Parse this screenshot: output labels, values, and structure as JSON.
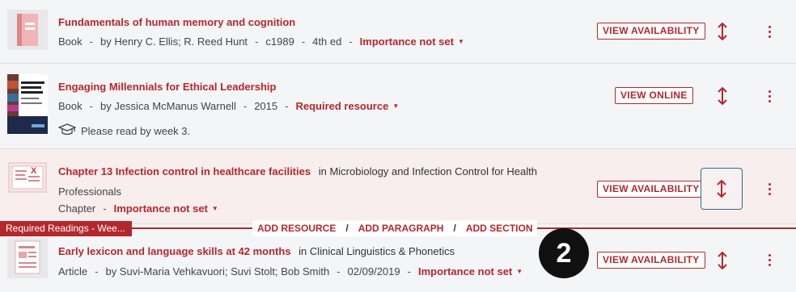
{
  "items": [
    {
      "title": "Fundamentals of human memory and cognition",
      "type": "Book",
      "authors": "by Henry C. Ellis; R. Reed Hunt",
      "date": "c1989",
      "edition": "4th ed",
      "importance": "Importance not set",
      "action": "VIEW AVAILABILITY"
    },
    {
      "title": "Engaging Millennials for Ethical Leadership",
      "type": "Book",
      "authors": "by Jessica McManus Warnell",
      "date": "2015",
      "importance": "Required resource",
      "note": "Please read by week 3.",
      "action": "VIEW ONLINE",
      "cover_text": "Engaging Millennials for Ethical Leadership"
    },
    {
      "title": "Chapter 13 Infection control in healthcare facilities",
      "in_prefix": "in",
      "container_line1": "Microbiology and Infection Control for Health",
      "container_line2": "Professionals",
      "type": "Chapter",
      "importance": "Importance not set",
      "action": "VIEW AVAILABILITY"
    },
    {
      "title": "Early lexicon and language skills at 42 months",
      "in_prefix": "in",
      "container_line1": "Clinical Linguistics & Phonetics",
      "type": "Article",
      "authors": "by Suvi-Maria Vehkavuori; Suvi Stolt; Bob Smith",
      "date": "02/09/2019",
      "importance": "Importance not set",
      "action": "VIEW AVAILABILITY"
    }
  ],
  "section": {
    "label": "Required Readings - Wee...",
    "add_resource": "ADD RESOURCE",
    "add_paragraph": "ADD PARAGRAPH",
    "add_section": "ADD SECTION",
    "separator": "/"
  },
  "meta_separator": "-",
  "step_badge": "2",
  "colors": {
    "accent": "#b3282d",
    "highlight_row": "#f8eeee",
    "focus_border": "#2f6f80"
  },
  "icons": [
    "book-icon",
    "graduation-cap-icon",
    "chapter-icon",
    "article-icon",
    "move-arrows-icon",
    "kebab-menu-icon",
    "caret-down-icon"
  ]
}
